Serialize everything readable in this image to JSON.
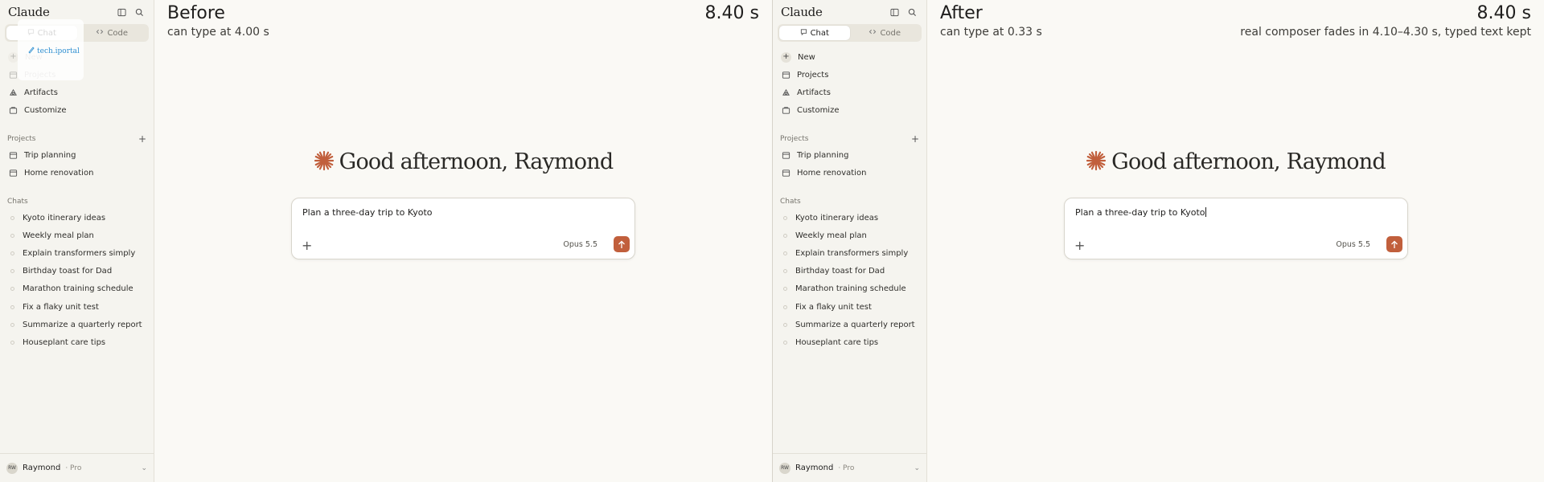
{
  "sidebar": {
    "app_name": "Claude",
    "modes": [
      "Chat",
      "Code"
    ],
    "nav": [
      "New",
      "Projects",
      "Artifacts",
      "Customize"
    ],
    "projects_header": "Projects",
    "projects": [
      "Trip planning",
      "Home renovation"
    ],
    "chats_header": "Chats",
    "chats": [
      "Kyoto itinerary ideas",
      "Weekly meal plan",
      "Explain transformers simply",
      "Birthday toast for Dad",
      "Marathon training schedule",
      "Fix a flaky unit test",
      "Summarize a quarterly report",
      "Houseplant care tips"
    ],
    "user": {
      "initials": "RW",
      "name": "Raymond",
      "plan": "· Pro"
    }
  },
  "main": {
    "greeting": "Good afternoon, Raymond",
    "composer_text": "Plan a three-day trip to Kyoto",
    "model": "Opus 5.5"
  },
  "before": {
    "title": "Before",
    "subtitle": "can type at 4.00 s",
    "timer": "8.40 s",
    "popover_logo": "tech.iportal"
  },
  "after": {
    "title": "After",
    "subtitle": "can type at 0.33 s",
    "timer": "8.40 s",
    "note": "real composer fades in 4.10–4.30 s, typed text kept"
  },
  "colors": {
    "accent": "#c15f3c",
    "background": "#faf9f5",
    "sidebar": "#f5f4ef",
    "popover_logo": "#2f8fd1"
  },
  "icons": [
    "sidebar-toggle-icon",
    "search-icon",
    "chat-bubble-icon",
    "code-icon",
    "plus-icon",
    "folder-icon",
    "artifacts-icon",
    "customize-icon",
    "claude-spark-icon",
    "arrow-up-icon",
    "chevron-down-icon"
  ]
}
